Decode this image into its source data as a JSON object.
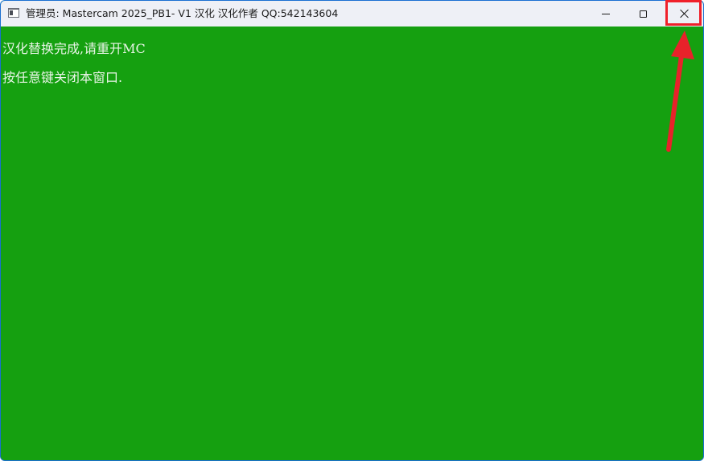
{
  "window": {
    "title": "管理员:  Mastercam 2025_PB1- V1 汉化  汉化作者 QQ:542143604",
    "icon": "console-window-icon",
    "controls": {
      "minimize_icon": "minimize-icon",
      "maximize_icon": "maximize-icon",
      "close_icon": "close-icon"
    }
  },
  "console": {
    "lines": [
      "汉化替换完成,请重开MC",
      "按任意键关闭本窗口."
    ],
    "background_color": "#15a010",
    "text_color": "#e8f4e6"
  },
  "annotation": {
    "highlight_color": "#f0202a",
    "arrow_icon": "red-arrow-icon"
  }
}
